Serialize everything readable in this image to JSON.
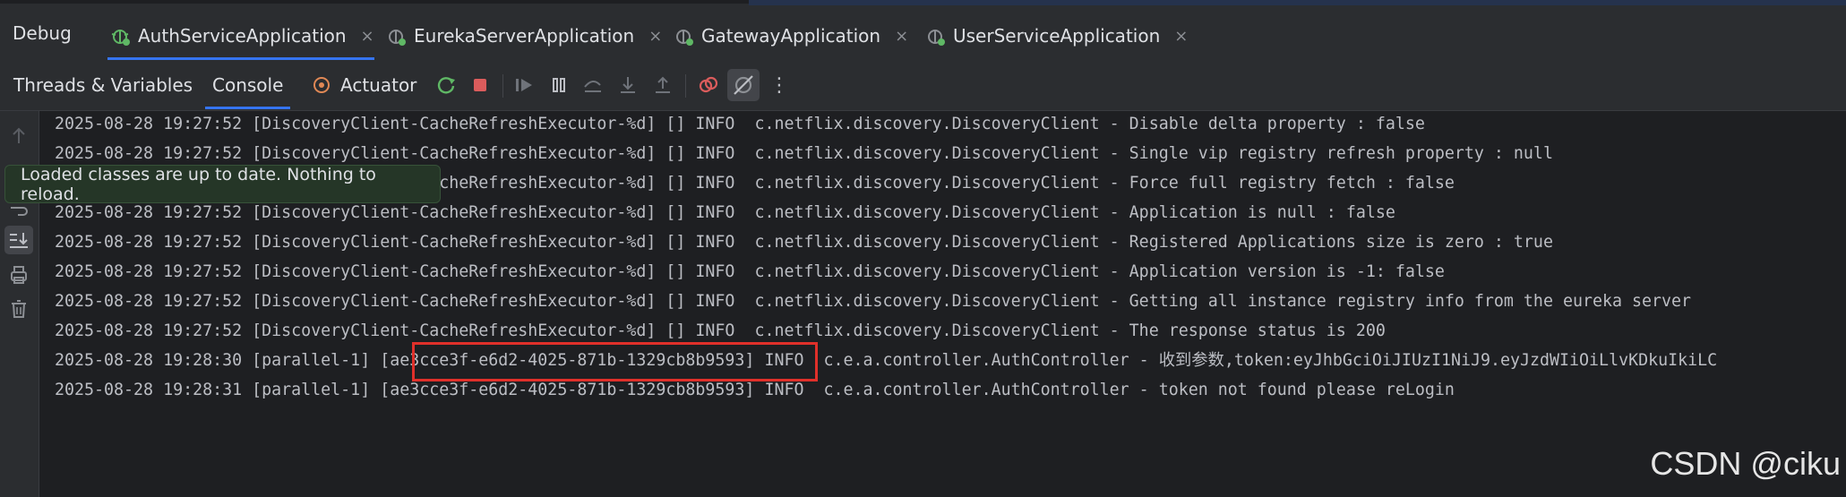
{
  "debug_title": "Debug",
  "tabs": [
    {
      "label": "AuthServiceApplication",
      "active": true
    },
    {
      "label": "EurekaServerApplication",
      "active": false
    },
    {
      "label": "GatewayApplication",
      "active": false
    },
    {
      "label": "UserServiceApplication",
      "active": false
    }
  ],
  "close_glyph": "×",
  "toolbar": {
    "threads": "Threads & Variables",
    "console": "Console",
    "actuator": "Actuator",
    "more": "⋮"
  },
  "colors": {
    "accent": "#3574f0",
    "stop": "#db5c5c",
    "highlight": "#e0302a",
    "tooltip_bg": "#253627"
  },
  "icons": [
    "bug-icon",
    "actuator-icon",
    "rerun-icon",
    "stop-icon",
    "resume-icon",
    "pause-icon",
    "step-over-icon",
    "step-into-icon",
    "step-out-icon",
    "view-breakpoints-icon",
    "mute-breakpoints-icon",
    "up-arrow-icon",
    "soft-wrap-icon",
    "scroll-to-end-icon",
    "print-icon",
    "trash-icon"
  ],
  "tooltip": "Loaded classes are up to date. Nothing to reload.",
  "console_lines": [
    "2025-08-28 19:27:52 [DiscoveryClient-CacheRefreshExecutor-%d] [] INFO  c.netflix.discovery.DiscoveryClient - Disable delta property : false",
    "2025-08-28 19:27:52 [DiscoveryClient-CacheRefreshExecutor-%d] [] INFO  c.netflix.discovery.DiscoveryClient - Single vip registry refresh property : null",
    "2025-08-28 19:27:52 [DiscoveryClient-CacheRefreshExecutor-%d] [] INFO  c.netflix.discovery.DiscoveryClient - Force full registry fetch : false",
    "2025-08-28 19:27:52 [DiscoveryClient-CacheRefreshExecutor-%d] [] INFO  c.netflix.discovery.DiscoveryClient - Application is null : false",
    "2025-08-28 19:27:52 [DiscoveryClient-CacheRefreshExecutor-%d] [] INFO  c.netflix.discovery.DiscoveryClient - Registered Applications size is zero : true",
    "2025-08-28 19:27:52 [DiscoveryClient-CacheRefreshExecutor-%d] [] INFO  c.netflix.discovery.DiscoveryClient - Application version is -1: false",
    "2025-08-28 19:27:52 [DiscoveryClient-CacheRefreshExecutor-%d] [] INFO  c.netflix.discovery.DiscoveryClient - Getting all instance registry info from the eureka server",
    "2025-08-28 19:27:52 [DiscoveryClient-CacheRefreshExecutor-%d] [] INFO  c.netflix.discovery.DiscoveryClient - The response status is 200",
    "2025-08-28 19:28:30 [parallel-1] [ae3cce3f-e6d2-4025-871b-1329cb8b9593] INFO  c.e.a.controller.AuthController - 收到参数,token:eyJhbGciOiJIUzI1NiJ9.eyJzdWIiOiLlvKDkuIkiLC",
    "2025-08-28 19:28:31 [parallel-1] [ae3cce3f-e6d2-4025-871b-1329cb8b9593] INFO  c.e.a.controller.AuthController - token not found please reLogin"
  ],
  "watermark": "CSDN @ciku"
}
